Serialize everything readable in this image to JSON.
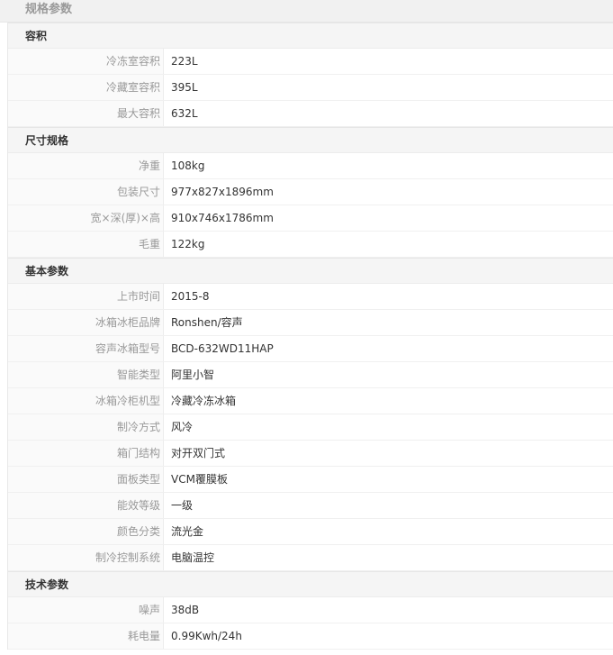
{
  "page_title": "规格参数",
  "sections": [
    {
      "title": "容积",
      "rows": [
        {
          "label": "冷冻室容积",
          "value": "223L"
        },
        {
          "label": "冷藏室容积",
          "value": "395L"
        },
        {
          "label": "最大容积",
          "value": "632L"
        }
      ]
    },
    {
      "title": "尺寸规格",
      "rows": [
        {
          "label": "净重",
          "value": "108kg"
        },
        {
          "label": "包装尺寸",
          "value": "977x827x1896mm"
        },
        {
          "label": "宽×深(厚)×高",
          "value": "910x746x1786mm"
        },
        {
          "label": "毛重",
          "value": "122kg"
        }
      ]
    },
    {
      "title": "基本参数",
      "rows": [
        {
          "label": "上市时间",
          "value": "2015-8"
        },
        {
          "label": "冰箱冰柜品牌",
          "value": "Ronshen/容声"
        },
        {
          "label": "容声冰箱型号",
          "value": "BCD-632WD11HAP"
        },
        {
          "label": "智能类型",
          "value": "阿里小智"
        },
        {
          "label": "冰箱冷柜机型",
          "value": "冷藏冷冻冰箱"
        },
        {
          "label": "制冷方式",
          "value": "风冷"
        },
        {
          "label": "箱门结构",
          "value": "对开双门式"
        },
        {
          "label": "面板类型",
          "value": "VCM覆膜板"
        },
        {
          "label": "能效等级",
          "value": "一级"
        },
        {
          "label": "颜色分类",
          "value": "流光金"
        },
        {
          "label": "制冷控制系统",
          "value": "电脑温控"
        }
      ]
    },
    {
      "title": "技术参数",
      "rows": [
        {
          "label": "噪声",
          "value": "38dB"
        },
        {
          "label": "耗电量",
          "value": "0.99Kwh/24h"
        }
      ]
    }
  ]
}
